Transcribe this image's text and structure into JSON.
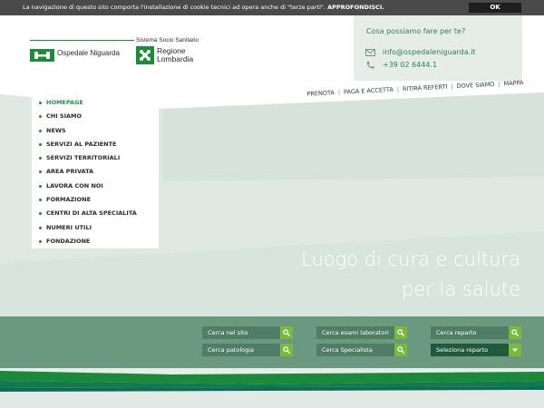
{
  "cookie": {
    "text": "La navigazione di questo sito comporta l'installazione di cookie tecnici ad opera anche di \"terze parti\".",
    "link": "APPROFONDISCI.",
    "ok_label": "OK"
  },
  "logo": {
    "hospital_name": "Ospedale Niguarda",
    "system_label": "Sistema Socio Sanitario",
    "region_line1": "Regione",
    "region_line2": "Lombardia"
  },
  "contact": {
    "title": "Cosa possiamo fare per te?",
    "email": "info@ospedaleniguarda.it",
    "phone": "+39 02 6444.1"
  },
  "top_nav": [
    "PRENOTA",
    "PAGA E ACCETTA",
    "RITIRA REFERTI",
    "DOVE SIAMO",
    "MAPPA"
  ],
  "side_nav": [
    "HOMEPAGE",
    "CHI SIAMO",
    "NEWS",
    "SERVIZI AL PAZIENTE",
    "SERVIZI TERRITORIALI",
    "AREA PRIVATA",
    "LAVORA CON NOI",
    "FORMAZIONE",
    "CENTRI DI ALTA SPECIALITÀ",
    "NUMERI UTILI",
    "FONDAZIONE"
  ],
  "hero": {
    "line1": "Luogo di cura e cultura",
    "line2": "per la salute"
  },
  "search": {
    "site": "Cerca nel sito",
    "pathology": "Cerca patologia",
    "lab_tests": "Cerca esami laboratori",
    "specialist": "Cerca Specialista",
    "department": "Cerca reparto",
    "select_department": "Seleziona reparto"
  },
  "colors": {
    "brand_green": "#1d8a3c",
    "accent_lime": "#7ab93a",
    "teal_text": "#2f7f5e",
    "search_band": "#6b9980"
  }
}
